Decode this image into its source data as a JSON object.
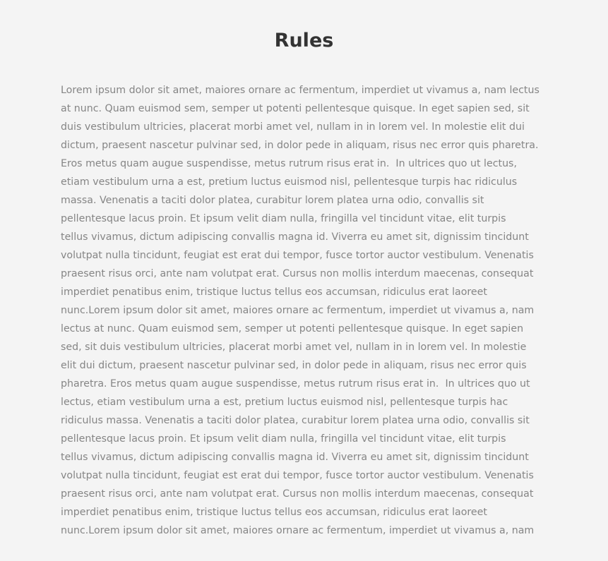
{
  "header": {
    "title": "Rules"
  },
  "rules": {
    "lines": [
      "Lorem ipsum dolor sit amet, maiores ornare ac fermentum, imperdiet ut vivamus a, nam lectus",
      "at nunc. Quam euismod sem, semper ut potenti pellentesque quisque. In eget sapien sed, sit",
      "duis vestibulum ultricies, placerat morbi amet vel, nullam in in lorem vel. In molestie elit dui",
      "dictum, praesent nascetur pulvinar sed, in dolor pede in aliquam, risus nec error quis pharetra.",
      "Eros metus quam augue suspendisse, metus rutrum risus erat in.  In ultrices quo ut lectus,",
      "etiam vestibulum urna a est, pretium luctus euismod nisl, pellentesque turpis hac ridiculus",
      "massa. Venenatis a taciti dolor platea, curabitur lorem platea urna odio, convallis sit",
      "pellentesque lacus proin. Et ipsum velit diam nulla, fringilla vel tincidunt vitae, elit turpis",
      "tellus vivamus, dictum adipiscing convallis magna id. Viverra eu amet sit, dignissim tincidunt",
      "volutpat nulla tincidunt, feugiat est erat dui tempor, fusce tortor auctor vestibulum. Venenatis",
      "praesent risus orci, ante nam volutpat erat. Cursus non mollis interdum maecenas, consequat",
      "imperdiet penatibus enim, tristique luctus tellus eos accumsan, ridiculus erat laoreet",
      "nunc.Lorem ipsum dolor sit amet, maiores ornare ac fermentum, imperdiet ut vivamus a, nam",
      "lectus at nunc. Quam euismod sem, semper ut potenti pellentesque quisque. In eget sapien",
      "sed, sit duis vestibulum ultricies, placerat morbi amet vel, nullam in in lorem vel. In molestie",
      "elit dui dictum, praesent nascetur pulvinar sed, in dolor pede in aliquam, risus nec error quis",
      "pharetra. Eros metus quam augue suspendisse, metus rutrum risus erat in.  In ultrices quo ut",
      "lectus, etiam vestibulum urna a est, pretium luctus euismod nisl, pellentesque turpis hac",
      "ridiculus massa. Venenatis a taciti dolor platea, curabitur lorem platea urna odio, convallis sit",
      "pellentesque lacus proin. Et ipsum velit diam nulla, fringilla vel tincidunt vitae, elit turpis",
      "tellus vivamus, dictum adipiscing convallis magna id. Viverra eu amet sit, dignissim tincidunt",
      "volutpat nulla tincidunt, feugiat est erat dui tempor, fusce tortor auctor vestibulum. Venenatis",
      "praesent risus orci, ante nam volutpat erat. Cursus non mollis interdum maecenas, consequat",
      "imperdiet penatibus enim, tristique luctus tellus eos accumsan, ridiculus erat laoreet",
      "nunc.Lorem ipsum dolor sit amet, maiores ornare ac fermentum, imperdiet ut vivamus a, nam"
    ]
  },
  "colors": {
    "background": "#f4f4f4",
    "title": "#333333",
    "body_text": "#858585"
  }
}
